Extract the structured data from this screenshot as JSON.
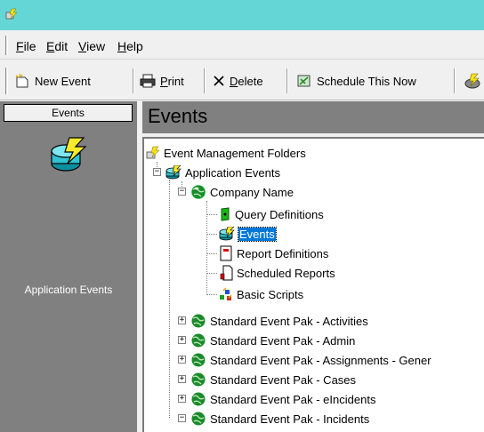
{
  "menu": {
    "file": {
      "ul": "F",
      "rest": "ile"
    },
    "edit": {
      "ul": "E",
      "rest": "dit"
    },
    "view": {
      "ul": "V",
      "rest": "iew"
    },
    "help": {
      "ul": "H",
      "rest": "elp"
    }
  },
  "toolbar": {
    "new_event": "New Event",
    "print": {
      "ul": "P",
      "rest": "rint"
    },
    "delete": {
      "ul": "D",
      "rest": "elete"
    },
    "schedule": "Schedule This Now"
  },
  "left_panel": {
    "header": "Events",
    "item_label": "Application Events"
  },
  "content": {
    "title": "Events"
  },
  "tree": {
    "root": "Event Management Folders",
    "app_events": "Application Events",
    "company": "Company Name",
    "query_definitions": "Query Definitions",
    "events": "Events",
    "report_definitions": "Report Definitions",
    "scheduled_reports": "Scheduled Reports",
    "basic_scripts": "Basic Scripts",
    "paks": [
      "Standard Event Pak - Activities",
      "Standard Event Pak - Admin",
      "Standard Event Pak - Assignments - Gener",
      "Standard Event Pak - Cases",
      "Standard Event Pak - eIncidents",
      "Standard Event Pak - Incidents"
    ]
  },
  "colors": {
    "titlebar": "#65d6d6",
    "panel": "#808080",
    "selection": "#0078d7"
  }
}
